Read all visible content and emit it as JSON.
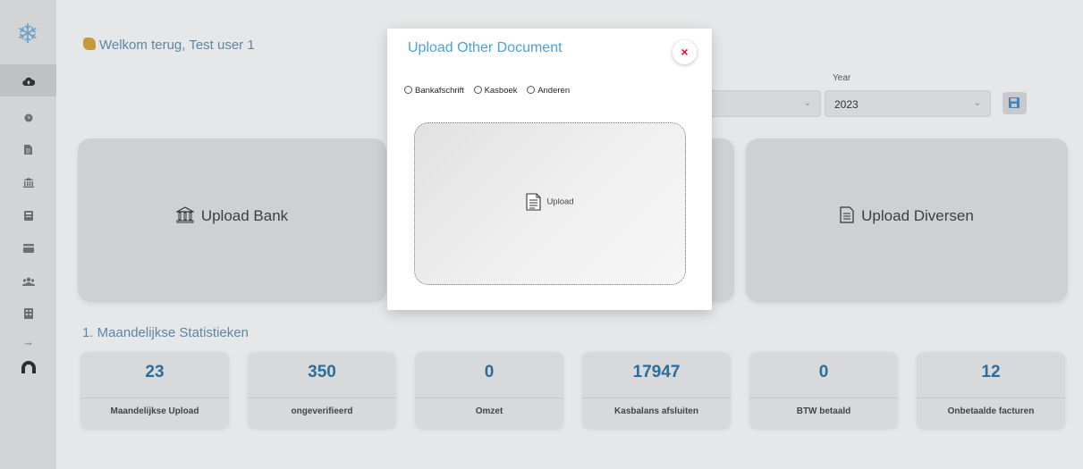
{
  "app": {
    "welcome_text": "Welkom terug, Test user 1"
  },
  "sidebar": {
    "items": [
      {
        "icon": "cloud-upload-icon",
        "active": true
      },
      {
        "icon": "clock-icon"
      },
      {
        "icon": "document-icon"
      },
      {
        "icon": "bank-icon"
      },
      {
        "icon": "calculator-icon"
      },
      {
        "icon": "card-icon"
      },
      {
        "icon": "users-icon"
      },
      {
        "icon": "building-icon"
      },
      {
        "icon": "arrow-right-icon"
      },
      {
        "icon": "avatar-icon"
      }
    ]
  },
  "filters": {
    "year_label": "Year",
    "year_value": "2023"
  },
  "cards": {
    "bank_label": "Upload Bank",
    "diversen_label": "Upload Diversen"
  },
  "stats": {
    "section_title": "1. Maandelijkse Statistieken",
    "items": [
      {
        "value": "23",
        "label": "Maandelijkse Upload"
      },
      {
        "value": "350",
        "label": "ongeverifieerd"
      },
      {
        "value": "0",
        "label": "Omzet"
      },
      {
        "value": "17947",
        "label": "Kasbalans afsluiten"
      },
      {
        "value": "0",
        "label": "BTW betaald"
      },
      {
        "value": "12",
        "label": "Onbetaalde facturen"
      }
    ]
  },
  "modal": {
    "title": "Upload Other Document",
    "close_label": "×",
    "options": [
      "Bankafschrift",
      "Kasboek",
      "Anderen"
    ],
    "upload_label": "Upload"
  },
  "colors": {
    "accent": "#4aa1dc",
    "stat_number": "#2a6e9e",
    "close": "#e0123a"
  }
}
